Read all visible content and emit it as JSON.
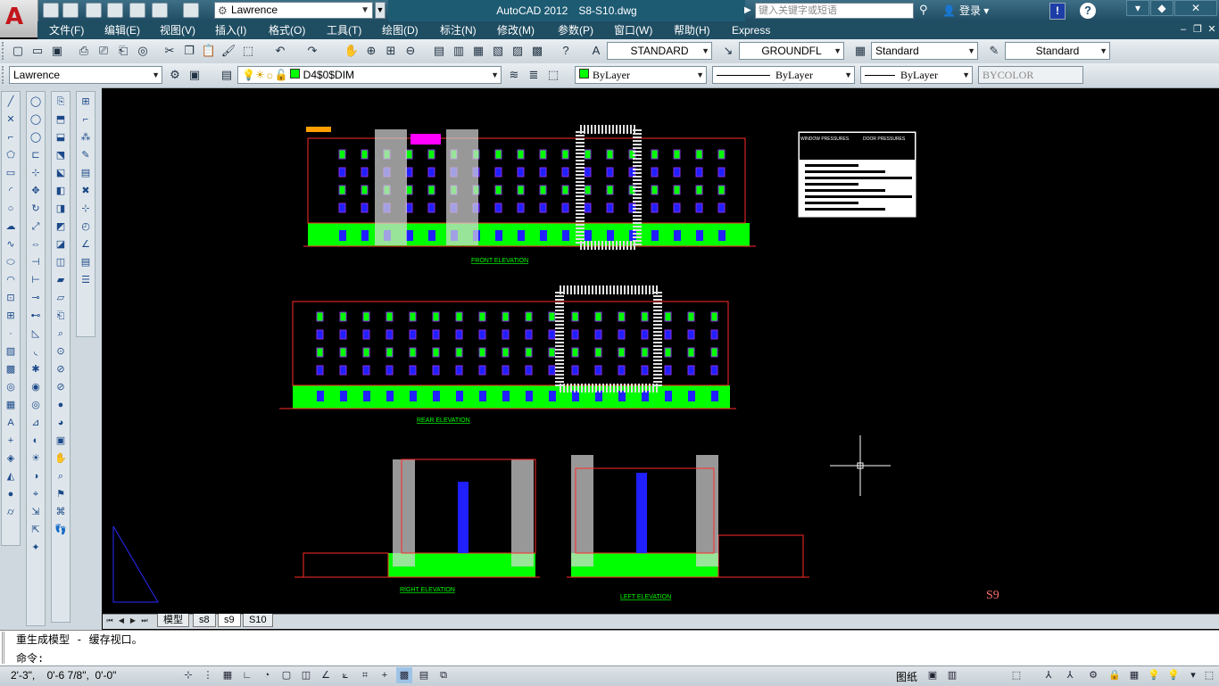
{
  "app": {
    "name": "AutoCAD 2012",
    "file": "S8-S10.dwg",
    "logo": "A",
    "workspace": "Lawrence",
    "search_placeholder": "键入关键字或短语",
    "login": "登录"
  },
  "menu": [
    "文件(F)",
    "编辑(E)",
    "视图(V)",
    "插入(I)",
    "格式(O)",
    "工具(T)",
    "绘图(D)",
    "标注(N)",
    "修改(M)",
    "参数(P)",
    "窗口(W)",
    "帮助(H)",
    "Express"
  ],
  "styles": {
    "text_style": "STANDARD",
    "dim_style": "GROUNDFL",
    "table_style": "Standard",
    "multileader_style": "Standard"
  },
  "layers": {
    "workspace2": "Lawrence",
    "current_layer": "D4$0$DIM",
    "color": "ByLayer",
    "linetype": "ByLayer",
    "lineweight": "ByLayer",
    "plotstyle": "BYCOLOR"
  },
  "drawing": {
    "sheet": "S9",
    "labels": {
      "front": "FRONT ELEVATION",
      "rear": "REAR ELEVATION",
      "right": "RIGHT ELEVATION",
      "left": "LEFT ELEVATION"
    },
    "table_headers": [
      "WINDOW PRESSURES",
      "DOOR PRESSURES"
    ]
  },
  "tabs": [
    "模型",
    "s8",
    "s9",
    "S10"
  ],
  "active_tab": "s9",
  "command": {
    "history": "重生成模型 - 缓存视口。",
    "prompt": "命令:"
  },
  "status": {
    "coords": "2'-3\",    0'-6 7/8\",  0'-0\"",
    "layout_label": "图纸"
  },
  "colors": {
    "title_bg": "#1d5b73",
    "canvas_bg": "#000000",
    "wall_red": "#ff2a2a",
    "ground_green": "#00ff00",
    "window_blue": "#2020ff",
    "accent_magenta": "#ff00ff"
  }
}
